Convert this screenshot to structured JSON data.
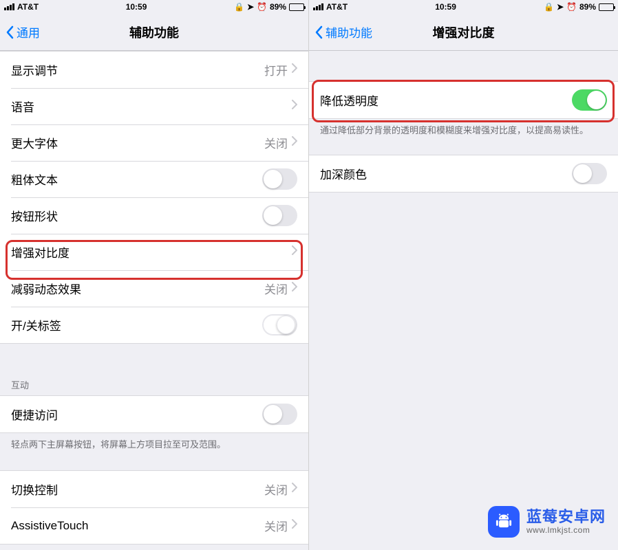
{
  "status": {
    "carrier": "AT&T",
    "time": "10:59",
    "battery": "89%"
  },
  "left": {
    "back_label": "通用",
    "title": "辅助功能",
    "rows": {
      "display_accommodations": {
        "label": "显示调节",
        "value": "打开"
      },
      "speech": {
        "label": "语音"
      },
      "larger_text": {
        "label": "更大字体",
        "value": "关闭"
      },
      "bold_text": {
        "label": "粗体文本"
      },
      "button_shapes": {
        "label": "按钮形状"
      },
      "increase_contrast": {
        "label": "增强对比度"
      },
      "reduce_motion": {
        "label": "减弱动态效果",
        "value": "关闭"
      },
      "onoff_labels": {
        "label": "开/关标签"
      }
    },
    "interaction_header": "互动",
    "interaction": {
      "reachability": {
        "label": "便捷访问"
      },
      "reachability_note": "轻点两下主屏幕按钮，将屏幕上方项目拉至可及范围。",
      "switch_control": {
        "label": "切换控制",
        "value": "关闭"
      },
      "assistive_touch": {
        "label": "AssistiveTouch",
        "value": "关闭"
      }
    }
  },
  "right": {
    "back_label": "辅助功能",
    "title": "增强对比度",
    "rows": {
      "reduce_transparency": {
        "label": "降低透明度"
      },
      "note": "通过降低部分背景的透明度和模糊度来增强对比度，以提高易读性。",
      "darken_colors": {
        "label": "加深颜色"
      }
    }
  },
  "watermark": {
    "title": "蓝莓安卓网",
    "url": "www.lmkjst.com"
  }
}
